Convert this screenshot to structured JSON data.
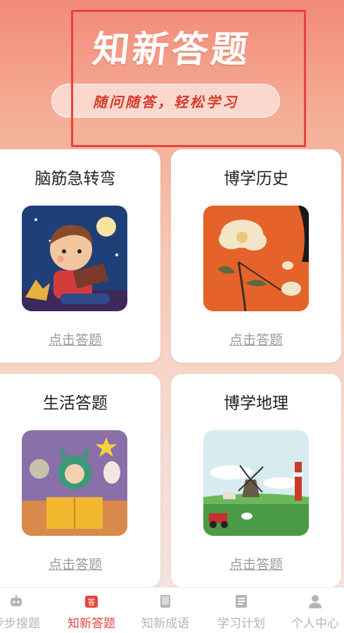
{
  "header": {
    "title": "知新答题",
    "slogan": "随问随答，轻松学习"
  },
  "cards": [
    {
      "title": "脑筋急转弯",
      "link": "点击答题",
      "image": "boy-reading-book"
    },
    {
      "title": "博学历史",
      "link": "点击答题",
      "image": "peony-flower-painting"
    },
    {
      "title": "生活答题",
      "link": "点击答题",
      "image": "child-reading-with-animals"
    },
    {
      "title": "博学地理",
      "link": "点击答题",
      "image": "windmill-farm-landscape"
    }
  ],
  "nav": [
    {
      "label": "步步搜题",
      "icon": "robot-icon",
      "active": false
    },
    {
      "label": "知新答题",
      "icon": "answer-icon",
      "active": true
    },
    {
      "label": "知新成语",
      "icon": "book-icon",
      "active": false
    },
    {
      "label": "学习计划",
      "icon": "plan-icon",
      "active": false
    },
    {
      "label": "个人中心",
      "icon": "user-icon",
      "active": false
    }
  ],
  "colors": {
    "accent": "#e4463c",
    "inactive": "#b5b5b5",
    "highlight_border": "#e8413b"
  }
}
